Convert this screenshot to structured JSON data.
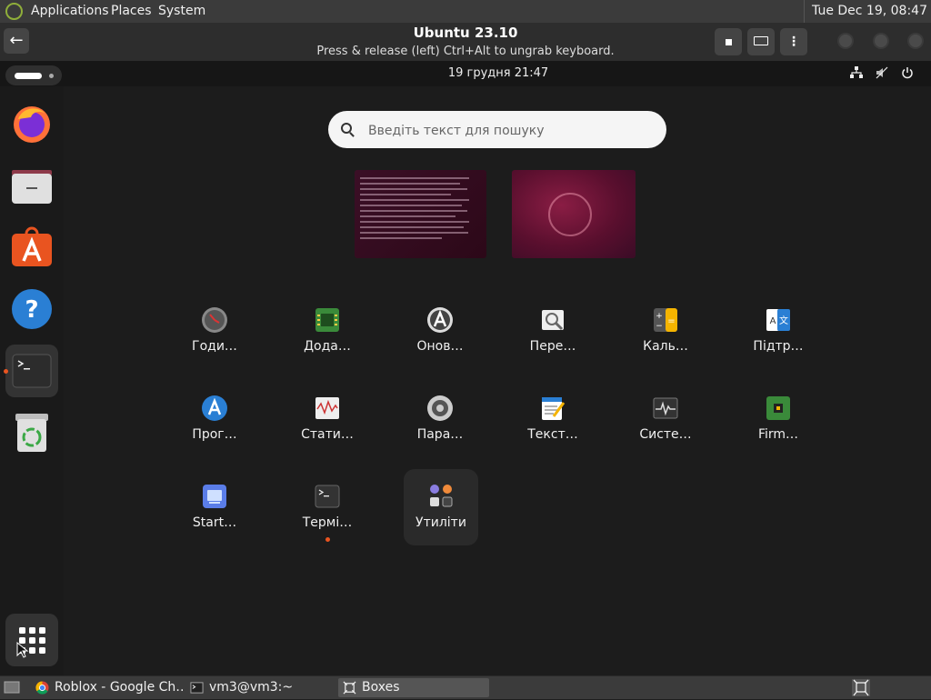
{
  "host_panel": {
    "menus": [
      "Applications",
      "Places",
      "System"
    ],
    "clock": "Tue Dec 19, 08:47"
  },
  "boxes": {
    "title": "Ubuntu 23.10",
    "subtitle": "Press & release (left) Ctrl+Alt to ungrab keyboard."
  },
  "guest": {
    "clock": "19 грудня  21:47",
    "search": {
      "placeholder": "Введіть текст для пошуку"
    },
    "apps": [
      {
        "label": "Годи…",
        "icon": "clock-icon"
      },
      {
        "label": "Дода…",
        "icon": "extensions-icon"
      },
      {
        "label": "Онов…",
        "icon": "software-updater-icon"
      },
      {
        "label": "Пере…",
        "icon": "document-viewer-icon"
      },
      {
        "label": "Каль…",
        "icon": "calculator-icon"
      },
      {
        "label": "Підтр…",
        "icon": "language-support-icon"
      },
      {
        "label": "Прог…",
        "icon": "app-center-icon"
      },
      {
        "label": "Стати…",
        "icon": "statistics-icon"
      },
      {
        "label": "Пара…",
        "icon": "settings-icon"
      },
      {
        "label": "Текст…",
        "icon": "text-editor-icon"
      },
      {
        "label": "Систе…",
        "icon": "system-monitor-icon"
      },
      {
        "label": "Firm…",
        "icon": "firmware-icon"
      },
      {
        "label": "Start…",
        "icon": "startup-disk-icon"
      },
      {
        "label": "Термі…",
        "icon": "terminal-icon"
      },
      {
        "label": "Утиліти",
        "icon": "utilities-folder-icon"
      }
    ]
  },
  "taskbar": [
    {
      "label": "Roblox - Google Ch…",
      "icon": "chrome-icon"
    },
    {
      "label": "vm3@vm3:~",
      "icon": "terminal-icon"
    },
    {
      "label": "Boxes",
      "icon": "boxes-icon"
    }
  ],
  "colors": {
    "accent": "#e95420",
    "host_panel": "#3b3b3b",
    "guest_bg": "#1c1c1c"
  }
}
